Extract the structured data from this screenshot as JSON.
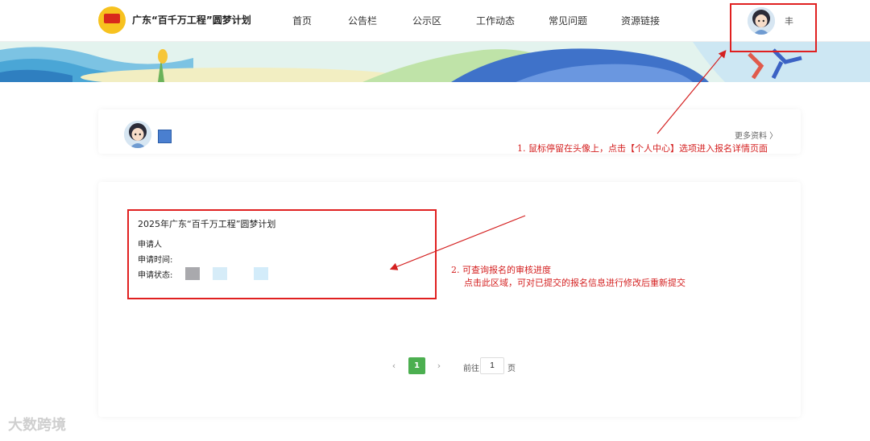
{
  "header": {
    "site_title": "广东“百千万工程”圆梦计划",
    "nav": [
      {
        "label": "首页"
      },
      {
        "label": "公告栏"
      },
      {
        "label": "公示区"
      },
      {
        "label": "工作动态"
      },
      {
        "label": "常见问题"
      },
      {
        "label": "资源链接"
      }
    ],
    "username": "丰"
  },
  "profile": {
    "more_link": "更多资料 〉"
  },
  "annotations": {
    "step1": "1. 鼠标停留在头像上，点击【个人中心】选项进入报名详情页面",
    "step2_line1": "2. 可查询报名的审核进度",
    "step2_line2": "点击此区域，可对已提交的报名信息进行修改后重新提交"
  },
  "application": {
    "title": "2025年广东“百千万工程”圆梦计划",
    "applicant_label": "申请人",
    "time_label": "申请时间:",
    "status_label": "申请状态:"
  },
  "pagination": {
    "prev": "‹",
    "current_page": "1",
    "next": "›",
    "goto_label": "前往",
    "goto_value": "1",
    "goto_suffix": "页"
  },
  "watermark": "大数跨境",
  "colors": {
    "annotation_red": "#d42020",
    "pager_green": "#4caf50"
  }
}
